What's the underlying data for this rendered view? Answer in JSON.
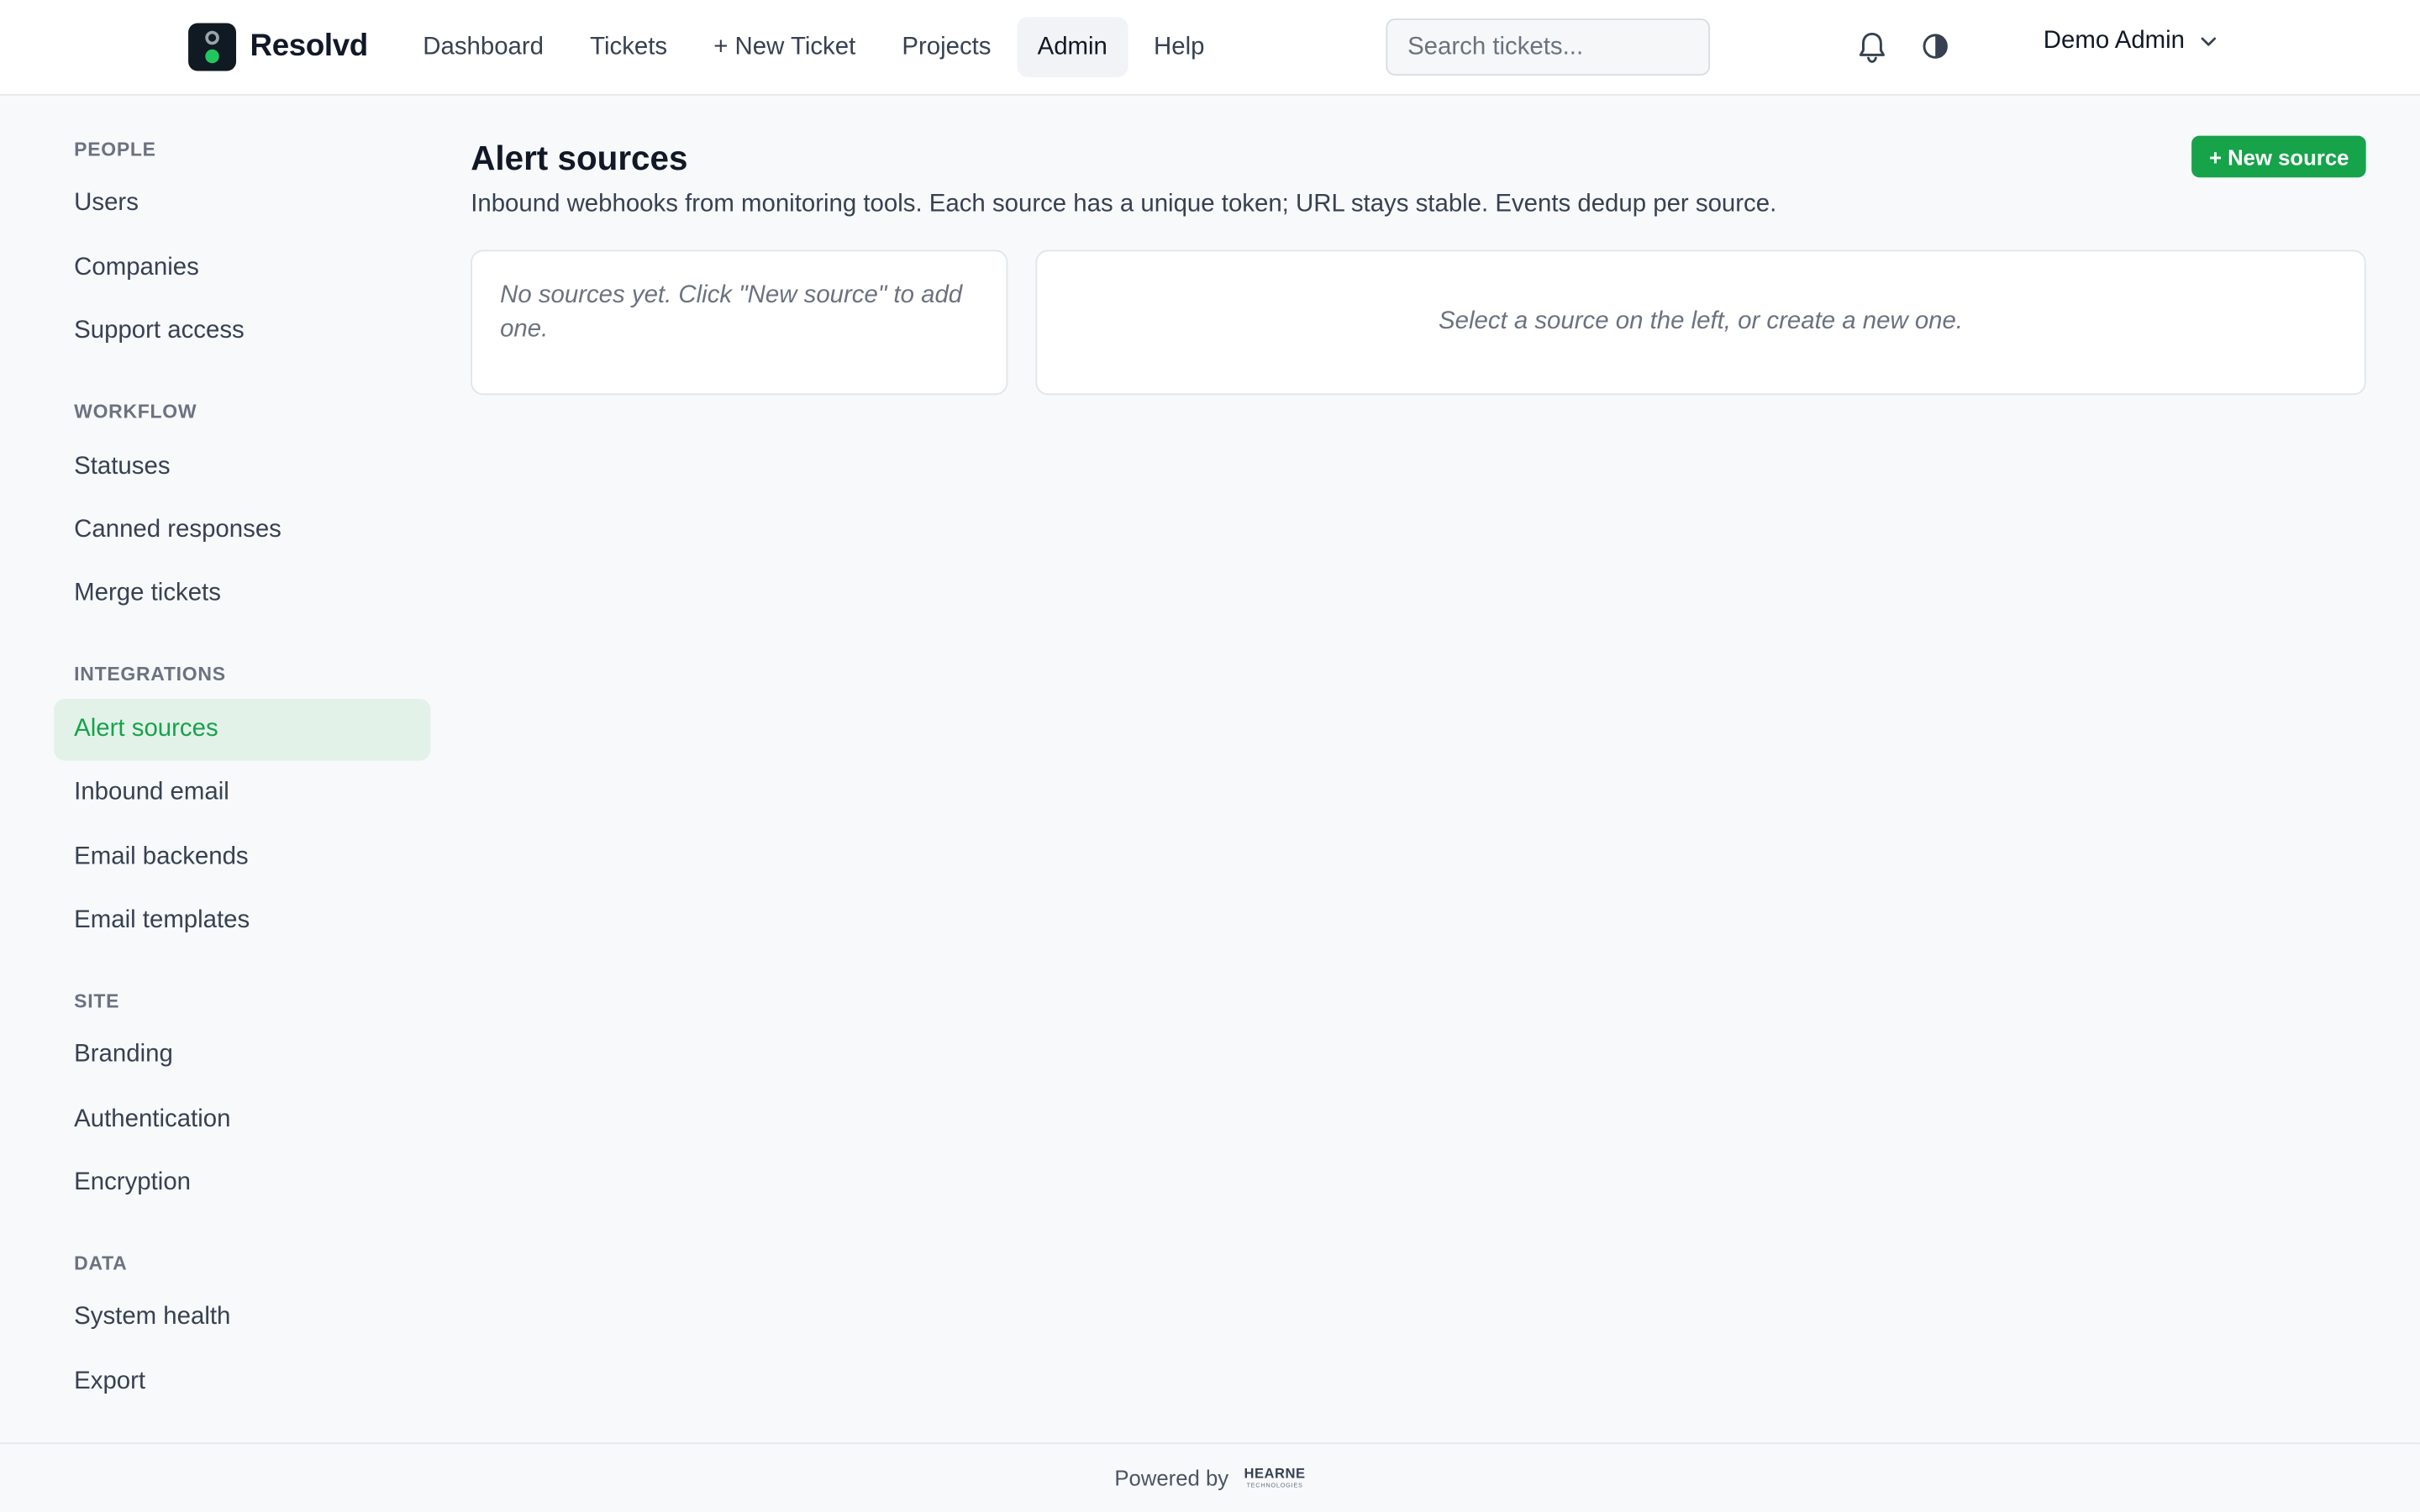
{
  "brand": {
    "name": "Resolvd"
  },
  "nav": {
    "items": [
      {
        "label": "Dashboard"
      },
      {
        "label": "Tickets"
      },
      {
        "label": "+ New Ticket"
      },
      {
        "label": "Projects"
      },
      {
        "label": "Admin",
        "active": true
      },
      {
        "label": "Help"
      }
    ]
  },
  "search": {
    "placeholder": "Search tickets..."
  },
  "icons": {
    "search": "search-icon",
    "bell": "bell-icon",
    "theme": "contrast-icon",
    "chevron": "chevron-down-icon"
  },
  "user": {
    "name": "Demo Admin"
  },
  "sidebar": {
    "groups": [
      {
        "label": "PEOPLE",
        "items": [
          "Users",
          "Companies",
          "Support access"
        ]
      },
      {
        "label": "WORKFLOW",
        "items": [
          "Statuses",
          "Canned responses",
          "Merge tickets"
        ]
      },
      {
        "label": "INTEGRATIONS",
        "items": [
          "Alert sources",
          "Inbound email",
          "Email backends",
          "Email templates"
        ]
      },
      {
        "label": "SITE",
        "items": [
          "Branding",
          "Authentication",
          "Encryption"
        ]
      },
      {
        "label": "DATA",
        "items": [
          "System health",
          "Export"
        ]
      }
    ],
    "active_item": "Alert sources"
  },
  "main": {
    "title": "Alert sources",
    "description": "Inbound webhooks from monitoring tools. Each source has a unique token; URL stays stable. Events dedup per source.",
    "new_button_label": "+ New source",
    "empty_list_text": "No sources yet. Click \"New source\" to add one.",
    "empty_detail_text": "Select a source on the left, or create a new one."
  },
  "footer": {
    "powered_by": "Powered by",
    "logo_text": "HEARNE",
    "logo_subtext": "TECHNOLOGIES"
  },
  "colors": {
    "accent": "#16a34a",
    "active_bg": "#e3f2e9",
    "page_bg": "#f7f9fb"
  }
}
